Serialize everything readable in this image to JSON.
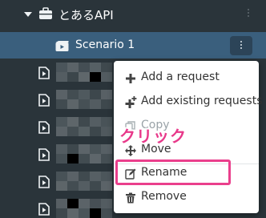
{
  "tree": {
    "api": {
      "label": "とあるAPI",
      "icon": "briefcase-icon",
      "expand_icon": "caret-down-icon"
    },
    "scenario": {
      "label": "Scenario 1",
      "icon": "film-icon",
      "menu_button_icon": "kebab-icon"
    },
    "requests": [
      {
        "icon": "document-play-icon"
      },
      {
        "icon": "document-play-icon"
      },
      {
        "icon": "document-play-icon"
      },
      {
        "icon": "document-play-icon"
      },
      {
        "icon": "document-play-icon"
      },
      {
        "icon": "document-play-icon"
      },
      {
        "icon": "document-play-icon"
      }
    ]
  },
  "context_menu": {
    "items": [
      {
        "label": "Add a request",
        "icon": "plus-icon",
        "enabled": true
      },
      {
        "label": "Add existing requests",
        "icon": "plus-icon",
        "enabled": true
      },
      {
        "label": "Copy",
        "icon": "copy-icon",
        "enabled": false
      },
      {
        "label": "Move",
        "icon": "move-icon",
        "enabled": true
      },
      {
        "label": "Rename",
        "icon": "edit-icon",
        "enabled": true
      },
      {
        "label": "Remove",
        "icon": "trash-icon",
        "enabled": true
      }
    ]
  },
  "annotation": {
    "text": "クリック",
    "color": "#e8398a"
  },
  "colors": {
    "sidebar_bg": "#2a343a",
    "selected_row": "#3a5f7d",
    "highlight_border": "#ea3f8c"
  }
}
